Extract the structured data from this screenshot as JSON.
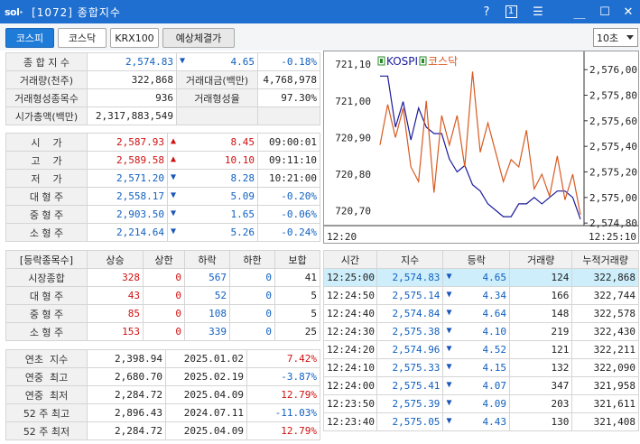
{
  "window": {
    "logo": "sol·",
    "title": "[1072] 종합지수",
    "help": "?",
    "one": "1",
    "menu": "☰",
    "minimize": "＿",
    "maximize": "☐",
    "close": "✕"
  },
  "tabs": [
    {
      "label": "코스피"
    },
    {
      "label": "코스닥"
    },
    {
      "label": "KRX100"
    },
    {
      "label": "예상체결가"
    }
  ],
  "interval": "10초",
  "summary": {
    "r0": {
      "label": "종 합 지 수",
      "value": "2,574.83",
      "change": "4.65",
      "pct": "-0.18%"
    },
    "r1": {
      "label": "거래량(천주)",
      "value": "322,868",
      "label2": "거래대금(백만)",
      "value2": "4,768,978"
    },
    "r2": {
      "label": "거래형성종목수",
      "value": "936",
      "label2": "거래형성율",
      "value2": "97.30%"
    },
    "r3": {
      "label": "시가총액(백만)",
      "value": "2,317,883,549"
    }
  },
  "prices": [
    {
      "label": "시    가",
      "value": "2,587.93",
      "change": "8.45",
      "time": "09:00:01",
      "dir": "up"
    },
    {
      "label": "고    가",
      "value": "2,589.58",
      "change": "10.10",
      "time": "09:11:10",
      "dir": "up"
    },
    {
      "label": "저    가",
      "value": "2,571.20",
      "change": "8.28",
      "time": "10:21:00",
      "dir": "dn"
    },
    {
      "label": "대 형 주",
      "value": "2,558.17",
      "change": "5.09",
      "time": "-0.20%",
      "dir": "dn"
    },
    {
      "label": "중 형 주",
      "value": "2,903.50",
      "change": "1.65",
      "time": "-0.06%",
      "dir": "dn"
    },
    {
      "label": "소 형 주",
      "value": "2,214.64",
      "change": "5.26",
      "time": "-0.24%",
      "dir": "dn"
    }
  ],
  "breadth": {
    "headers": [
      "[등락종목수]",
      "상승",
      "상한",
      "하락",
      "하한",
      "보합"
    ],
    "rows": [
      {
        "label": "시장종합",
        "up": "328",
        "uplim": "0",
        "down": "567",
        "downlim": "0",
        "flat": "41"
      },
      {
        "label": "대 형 주",
        "up": "43",
        "uplim": "0",
        "down": "52",
        "downlim": "0",
        "flat": "5"
      },
      {
        "label": "중 형 주",
        "up": "85",
        "uplim": "0",
        "down": "108",
        "downlim": "0",
        "flat": "5"
      },
      {
        "label": "소 형 주",
        "up": "153",
        "uplim": "0",
        "down": "339",
        "downlim": "0",
        "flat": "25"
      }
    ]
  },
  "yearly": [
    {
      "label": "연초  지수",
      "value": "2,398.94",
      "date": "2025.01.02",
      "pct": "7.42%",
      "dir": "up"
    },
    {
      "label": "연중  최고",
      "value": "2,680.70",
      "date": "2025.02.19",
      "pct": "-3.87%",
      "dir": "dn"
    },
    {
      "label": "연중  최저",
      "value": "2,284.72",
      "date": "2025.04.09",
      "pct": "12.79%",
      "dir": "up"
    },
    {
      "label": "52 주 최고",
      "value": "2,896.43",
      "date": "2024.07.11",
      "pct": "-11.03%",
      "dir": "dn"
    },
    {
      "label": "52 주 최저",
      "value": "2,284.72",
      "date": "2025.04.09",
      "pct": "12.79%",
      "dir": "up"
    }
  ],
  "ticks": {
    "headers": [
      "시간",
      "지수",
      "등락",
      "거래량",
      "누적거래량"
    ],
    "rows": [
      {
        "time": "12:25:00",
        "index": "2,574.83",
        "change": "4.65",
        "vol": "124",
        "cum": "322,868"
      },
      {
        "time": "12:24:50",
        "index": "2,575.14",
        "change": "4.34",
        "vol": "166",
        "cum": "322,744"
      },
      {
        "time": "12:24:40",
        "index": "2,574.84",
        "change": "4.64",
        "vol": "148",
        "cum": "322,578"
      },
      {
        "time": "12:24:30",
        "index": "2,575.38",
        "change": "4.10",
        "vol": "219",
        "cum": "322,430"
      },
      {
        "time": "12:24:20",
        "index": "2,574.96",
        "change": "4.52",
        "vol": "121",
        "cum": "322,211"
      },
      {
        "time": "12:24:10",
        "index": "2,575.33",
        "change": "4.15",
        "vol": "132",
        "cum": "322,090"
      },
      {
        "time": "12:24:00",
        "index": "2,575.41",
        "change": "4.07",
        "vol": "347",
        "cum": "321,958"
      },
      {
        "time": "12:23:50",
        "index": "2,575.39",
        "change": "4.09",
        "vol": "203",
        "cum": "321,611"
      },
      {
        "time": "12:23:40",
        "index": "2,575.05",
        "change": "4.43",
        "vol": "130",
        "cum": "321,408"
      }
    ]
  },
  "chart_data": {
    "type": "line",
    "legend": [
      "KOSPI",
      "코스닥"
    ],
    "x_start": "12:20",
    "x_end": "12:25:10",
    "left_axis": {
      "ticks": [
        "721,10",
        "721,00",
        "720,90",
        "720,80",
        "720,70"
      ],
      "range": [
        720.66,
        721.12
      ]
    },
    "right_axis": {
      "ticks": [
        "2,576,00",
        "2,575,80",
        "2,575,60",
        "2,575,40",
        "2,575,20",
        "2,575,00",
        "2,574,80"
      ],
      "range": [
        2574.78,
        2576.1
      ]
    },
    "series": [
      {
        "name": "KOSPI",
        "color": "#1a1a9c",
        "axis": "right",
        "values": [
          2575.95,
          2575.95,
          2575.55,
          2575.75,
          2575.45,
          2575.7,
          2575.55,
          2575.5,
          2575.5,
          2575.3,
          2575.2,
          2575.25,
          2575.1,
          2575.05,
          2574.95,
          2574.9,
          2574.85,
          2574.85,
          2574.95,
          2574.95,
          2575.0,
          2574.95,
          2575.0,
          2575.05,
          2575.05,
          2575.0,
          2574.83
        ]
      },
      {
        "name": "코스닥",
        "color": "#d85a20",
        "axis": "left",
        "values": [
          720.88,
          720.99,
          720.9,
          720.98,
          720.82,
          720.78,
          721.0,
          720.75,
          720.96,
          720.88,
          720.96,
          720.82,
          721.08,
          720.86,
          720.94,
          720.86,
          720.78,
          720.84,
          720.82,
          720.92,
          720.76,
          720.8,
          720.74,
          720.85,
          720.73,
          720.8,
          720.69
        ]
      }
    ]
  }
}
